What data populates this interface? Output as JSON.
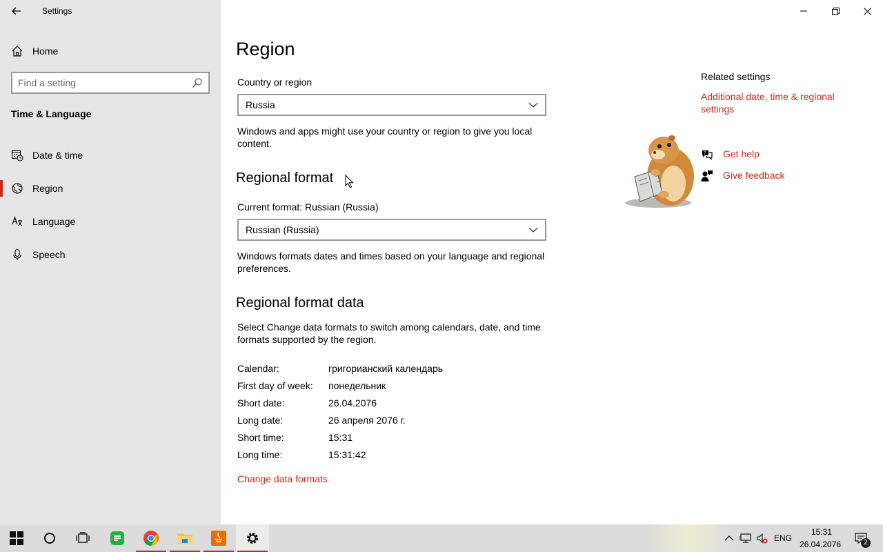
{
  "window": {
    "title": "Settings",
    "controls": {
      "minimize": "minimize-icon",
      "restore": "restore-icon",
      "close": "close-icon"
    }
  },
  "sidebar": {
    "home_label": "Home",
    "search_placeholder": "Find a setting",
    "section_title": "Time & Language",
    "items": [
      {
        "label": "Date & time",
        "icon": "calendar-clock-icon",
        "selected": false
      },
      {
        "label": "Region",
        "icon": "globe-icon",
        "selected": true
      },
      {
        "label": "Language",
        "icon": "language-icon",
        "selected": false
      },
      {
        "label": "Speech",
        "icon": "microphone-icon",
        "selected": false
      }
    ]
  },
  "main": {
    "title": "Region",
    "country_label": "Country or region",
    "country_value": "Russia",
    "country_desc": "Windows and apps might use your country or region to give you local content.",
    "format_heading": "Regional format",
    "current_format_label": "Current format: Russian (Russia)",
    "format_value": "Russian (Russia)",
    "format_desc": "Windows formats dates and times based on your language and regional preferences.",
    "data_heading": "Regional format data",
    "data_desc": "Select Change data formats to switch among calendars, date, and time formats supported by the region.",
    "rows": [
      {
        "key": "Calendar:",
        "value": "григорианский календарь"
      },
      {
        "key": "First day of week:",
        "value": "понедельник"
      },
      {
        "key": "Short date:",
        "value": "26.04.2076"
      },
      {
        "key": "Long date:",
        "value": "26 апреля 2076 г."
      },
      {
        "key": "Short time:",
        "value": "15:31"
      },
      {
        "key": "Long time:",
        "value": "15:31:42"
      }
    ],
    "change_link": "Change data formats"
  },
  "related": {
    "title": "Related settings",
    "link": "Additional date, time & regional settings",
    "help": "Get help",
    "feedback": "Give feedback"
  },
  "taskbar": {
    "apps": [
      "start-icon",
      "search-circle-icon",
      "task-view-icon",
      "messenger-icon",
      "chrome-icon",
      "file-explorer-icon",
      "java-app-icon",
      "settings-gear-icon"
    ],
    "language": "ENG",
    "time": "15:31",
    "date": "26.04.2076",
    "notifications": "2"
  },
  "colors": {
    "accent": "#c42b1c",
    "sidebar_bg": "#e6e6e6",
    "taskbar_bg": "#dcdcdc"
  }
}
